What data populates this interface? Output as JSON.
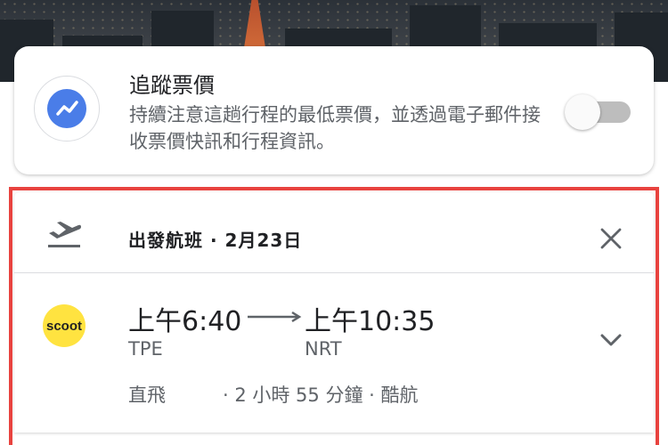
{
  "price_tracking": {
    "title": "追蹤票價",
    "description": "持續注意這趟行程的最低票價，並透過電子郵件接收票價快訊和行程資訊。",
    "toggle_on": false,
    "icon": "trending-line-icon"
  },
  "flight_leg": {
    "title": "出發航班 · 2月23日",
    "icon": "plane-departure-icon",
    "close_icon": "close-icon"
  },
  "flight": {
    "airline_logo_text": "scoot",
    "departure_time": "上午6:40",
    "arrival_time": "上午10:35",
    "departure_code": "TPE",
    "arrival_code": "NRT",
    "stops": "直飛",
    "details": "· 2 小時 55 分鐘 · 酷航",
    "expand_icon": "chevron-down-icon"
  },
  "colors": {
    "highlight": "#e8433f",
    "accent_blue": "#4a7de8",
    "scoot_yellow": "#ffe340"
  }
}
